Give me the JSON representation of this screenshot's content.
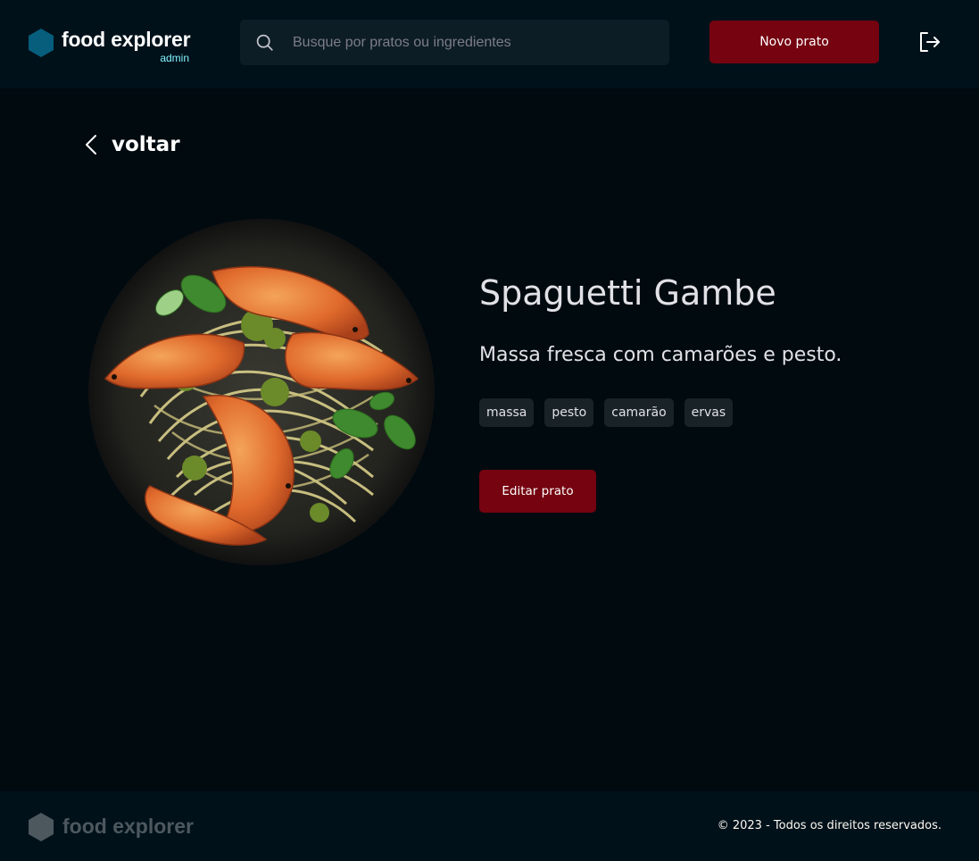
{
  "brand": {
    "name": "food explorer",
    "role": "admin",
    "icon": "hexagon-logo-icon",
    "color": "#065E7C"
  },
  "search": {
    "placeholder": "Busque por pratos ou ingredientes",
    "value": "",
    "icon": "search-icon"
  },
  "header": {
    "new_dish_label": "Novo prato",
    "signout_icon": "sign-out-icon"
  },
  "nav": {
    "back_label": "voltar",
    "back_icon": "chevron-left-icon"
  },
  "dish": {
    "name": "Spaguetti Gambe",
    "description": "Massa fresca com camarões e pesto.",
    "ingredients": [
      "massa",
      "pesto",
      "camarão",
      "ervas"
    ],
    "edit_label": "Editar prato",
    "image": "shrimp-pasta-photo"
  },
  "footer": {
    "brand": "food explorer",
    "copyright": "© 2023 - Todos os direitos reservados."
  },
  "colors": {
    "background": "#000A0F",
    "header": "#00111A",
    "input": "#0D1D25",
    "tomato": "#750310",
    "cake": "#82F3FF",
    "tag": "#192227"
  }
}
